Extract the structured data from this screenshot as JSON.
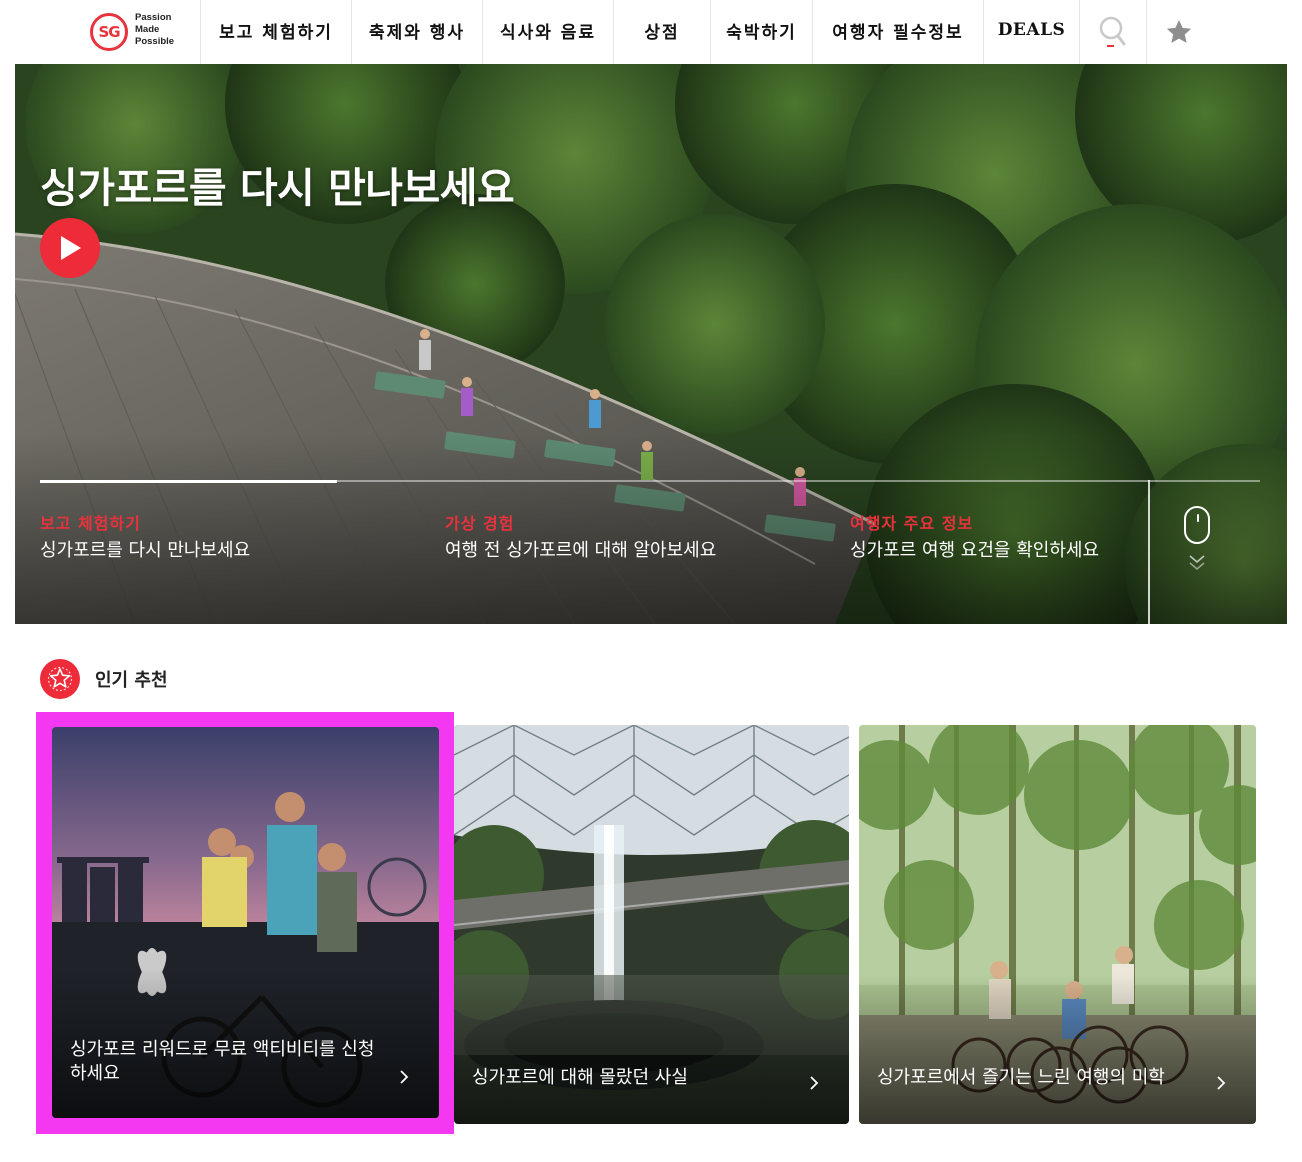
{
  "brand": {
    "logo_mark": "SG",
    "logo_line1": "Passion",
    "logo_line2": "Made",
    "logo_line3": "Possible",
    "accent_color": "#e8323c"
  },
  "nav": {
    "items": [
      {
        "label": "보고 체험하기"
      },
      {
        "label": "축제와 행사"
      },
      {
        "label": "식사와 음료"
      },
      {
        "label": "상점"
      },
      {
        "label": "숙박하기"
      },
      {
        "label": "여행자 필수정보"
      },
      {
        "label": "DEALS"
      }
    ],
    "search_icon": "search-icon",
    "favorites_icon": "star-icon"
  },
  "hero": {
    "title": "싱가포르를 다시 만나보세요",
    "play_icon": "play-icon",
    "slides": [
      {
        "category": "보고 체험하기",
        "text": "싱가포르를 다시 만나보세요"
      },
      {
        "category": "가상 경험",
        "text": "여행 전 싱가포르에 대해 알아보세요"
      },
      {
        "category": "여행자 주요 정보",
        "text": "싱가포르 여행 요건을 확인하세요"
      }
    ],
    "scroll_icon": "mouse-scroll-icon"
  },
  "popular": {
    "title": "인기 추천",
    "badge_icon": "star-badge-icon",
    "cards": [
      {
        "text": "싱가포르 리워드로 무료 액티비티를 신청하세요"
      },
      {
        "text": "싱가포르에 대해 몰랐던 사실"
      },
      {
        "text": "싱가포르에서 즐기는 느린 여행의 미학"
      }
    ]
  }
}
